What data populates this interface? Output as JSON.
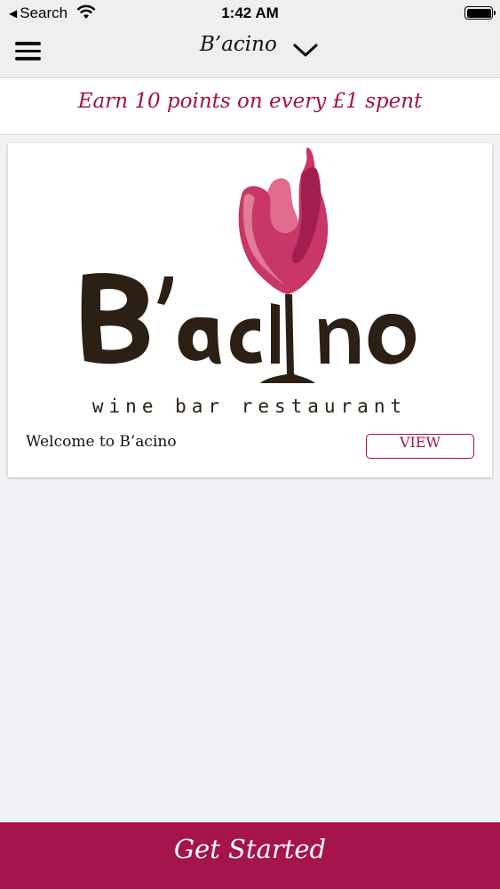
{
  "status_bar": {
    "back_label": "Search",
    "time": "1:42 AM",
    "icons": [
      "back-arrow-icon",
      "wifi-icon",
      "battery-icon"
    ]
  },
  "nav": {
    "title": "B’acino",
    "menu_icon": "hamburger-icon",
    "chevron_icon": "chevron-down-icon"
  },
  "promo": {
    "text": "Earn 10 points on every £1 spent"
  },
  "card": {
    "logo": {
      "brand": "B'acino",
      "tagline": "wine bar restaurant"
    },
    "title": "Welcome to B’acino",
    "button_label": "VIEW"
  },
  "footer": {
    "cta_label": "Get Started"
  },
  "colors": {
    "brand": "#a5144c",
    "logo_dark": "#2b2013",
    "background": "#f2f1f6"
  }
}
